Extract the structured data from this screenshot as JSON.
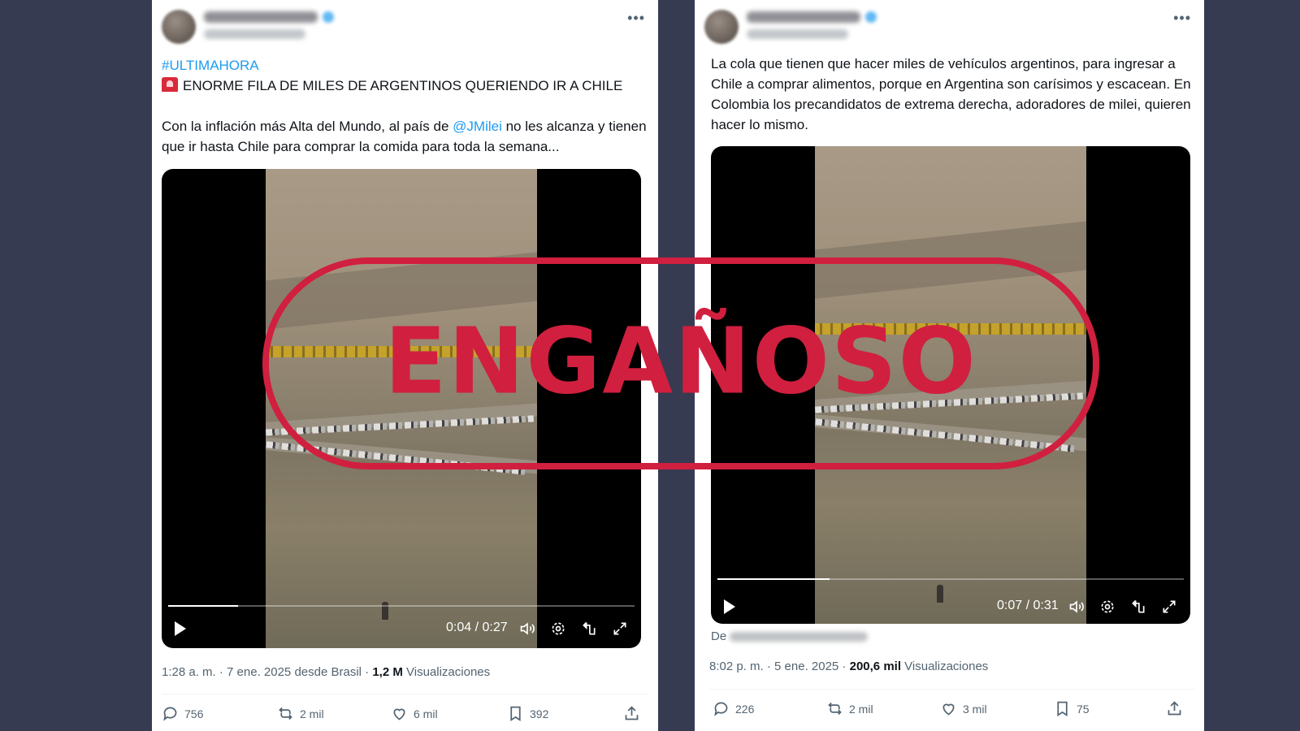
{
  "left_tweet": {
    "hashtag": "#ULTIMAHORA",
    "headline": "ENORME FILA DE MILES DE ARGENTINOS QUERIENDO IR A CHILE",
    "body_before": "Con la inflación más Alta del Mundo, al país de ",
    "mention": "@JMilei",
    "body_after": " no les alcanza y tienen que ir hasta Chile para comprar la comida para toda la semana...",
    "video": {
      "time": "0:04 / 0:27",
      "progress": 0.15
    },
    "meta_date": "1:28 a. m. · 7 ene. 2025 desde Brasil · ",
    "views_count": "1,2 M",
    "views_label": " Visualizaciones",
    "actions": {
      "replies": "756",
      "reposts": "2 mil",
      "likes": "6 mil",
      "bookmarks": "392"
    }
  },
  "right_tweet": {
    "body": "La cola que tienen que hacer miles de vehículos argentinos, para ingresar a Chile a comprar alimentos, porque en Argentina son carísimos y escacean. En Colombia los precandidatos de extrema derecha, adoradores de milei, quieren hacer lo mismo.",
    "video": {
      "time": "0:07 / 0:31",
      "progress": 0.24
    },
    "from_label": "De",
    "meta_date": "8:02 p. m. · 5 ene. 2025 · ",
    "views_count": "200,6 mil",
    "views_label": " Visualizaciones",
    "actions": {
      "replies": "226",
      "reposts": "2 mil",
      "likes": "3 mil",
      "bookmarks": "75"
    }
  },
  "stamp": {
    "text": "ENGAÑOSO",
    "color": "#d11f3f"
  },
  "colors": {
    "background": "#373b52",
    "link": "#1d9bf0",
    "muted": "#536471"
  },
  "icons": [
    "more-icon",
    "play-icon",
    "volume-icon",
    "settings-icon",
    "pip-icon",
    "fullscreen-icon",
    "reply-icon",
    "repost-icon",
    "like-icon",
    "bookmark-icon",
    "share-icon"
  ]
}
